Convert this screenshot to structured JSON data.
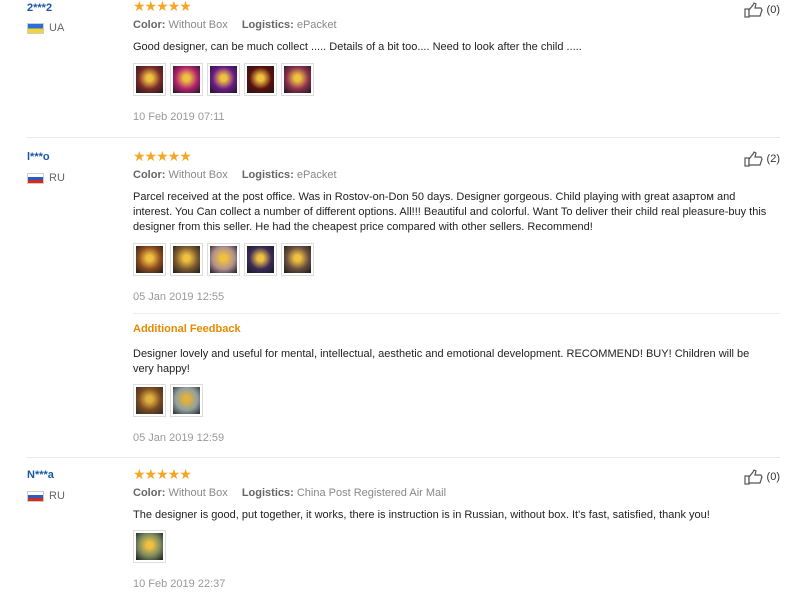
{
  "reviews": [
    {
      "user": "2***2",
      "country": "UA",
      "stars": "★★★★★",
      "color_label": "Color:",
      "color_value": "Without Box",
      "logistics_label": "Logistics:",
      "logistics_value": "ePacket",
      "likes": "(0)",
      "text": "Good designer, can be much collect ..... Details of a bit too.... Need to look after the child .....",
      "photos": [
        "#7a2a2a",
        "#b02070",
        "#6a1a8a",
        "#5a1010",
        "#8a3050"
      ],
      "date": "10 Feb 2019 07:11"
    },
    {
      "user": "l***o",
      "country": "RU",
      "stars": "★★★★★",
      "color_label": "Color:",
      "color_value": "Without Box",
      "logistics_label": "Logistics:",
      "logistics_value": "ePacket",
      "likes": "(2)",
      "text": "Parcel received at the post office. Was in Rostov-on-Don 50 days. Designer gorgeous. Child playing with great азартом and interest. You Can collect a number of different options. All!!! Beautiful and colorful. Want To deliver their child real pleasure-buy this designer from this seller. He had the cheapest price compared with other sellers. Recommend!",
      "photos": [
        "#8a4a20",
        "#7a5a30",
        "#b09090",
        "#3a2a5a",
        "#6a5040"
      ],
      "date": "05 Jan 2019 12:55",
      "additional_title": "Additional Feedback",
      "additional_text": "Designer lovely and useful for mental, intellectual, aesthetic and emotional development. RECOMMEND! BUY! Children will be very happy!",
      "additional_photos": [
        "#7a4a20",
        "#90a0a0"
      ],
      "additional_date": "05 Jan 2019 12:59"
    },
    {
      "user": "N***a",
      "country": "RU",
      "stars": "★★★★★",
      "color_label": "Color:",
      "color_value": "Without Box",
      "logistics_label": "Logistics:",
      "logistics_value": "China Post Registered Air Mail",
      "likes": "(0)",
      "text": "The designer is good, put together, it works, there is instruction is in Russian, without box. It's fast, satisfied, thank you!",
      "photos": [
        "#7a8a60"
      ],
      "date": "10 Feb 2019 22:37"
    }
  ]
}
